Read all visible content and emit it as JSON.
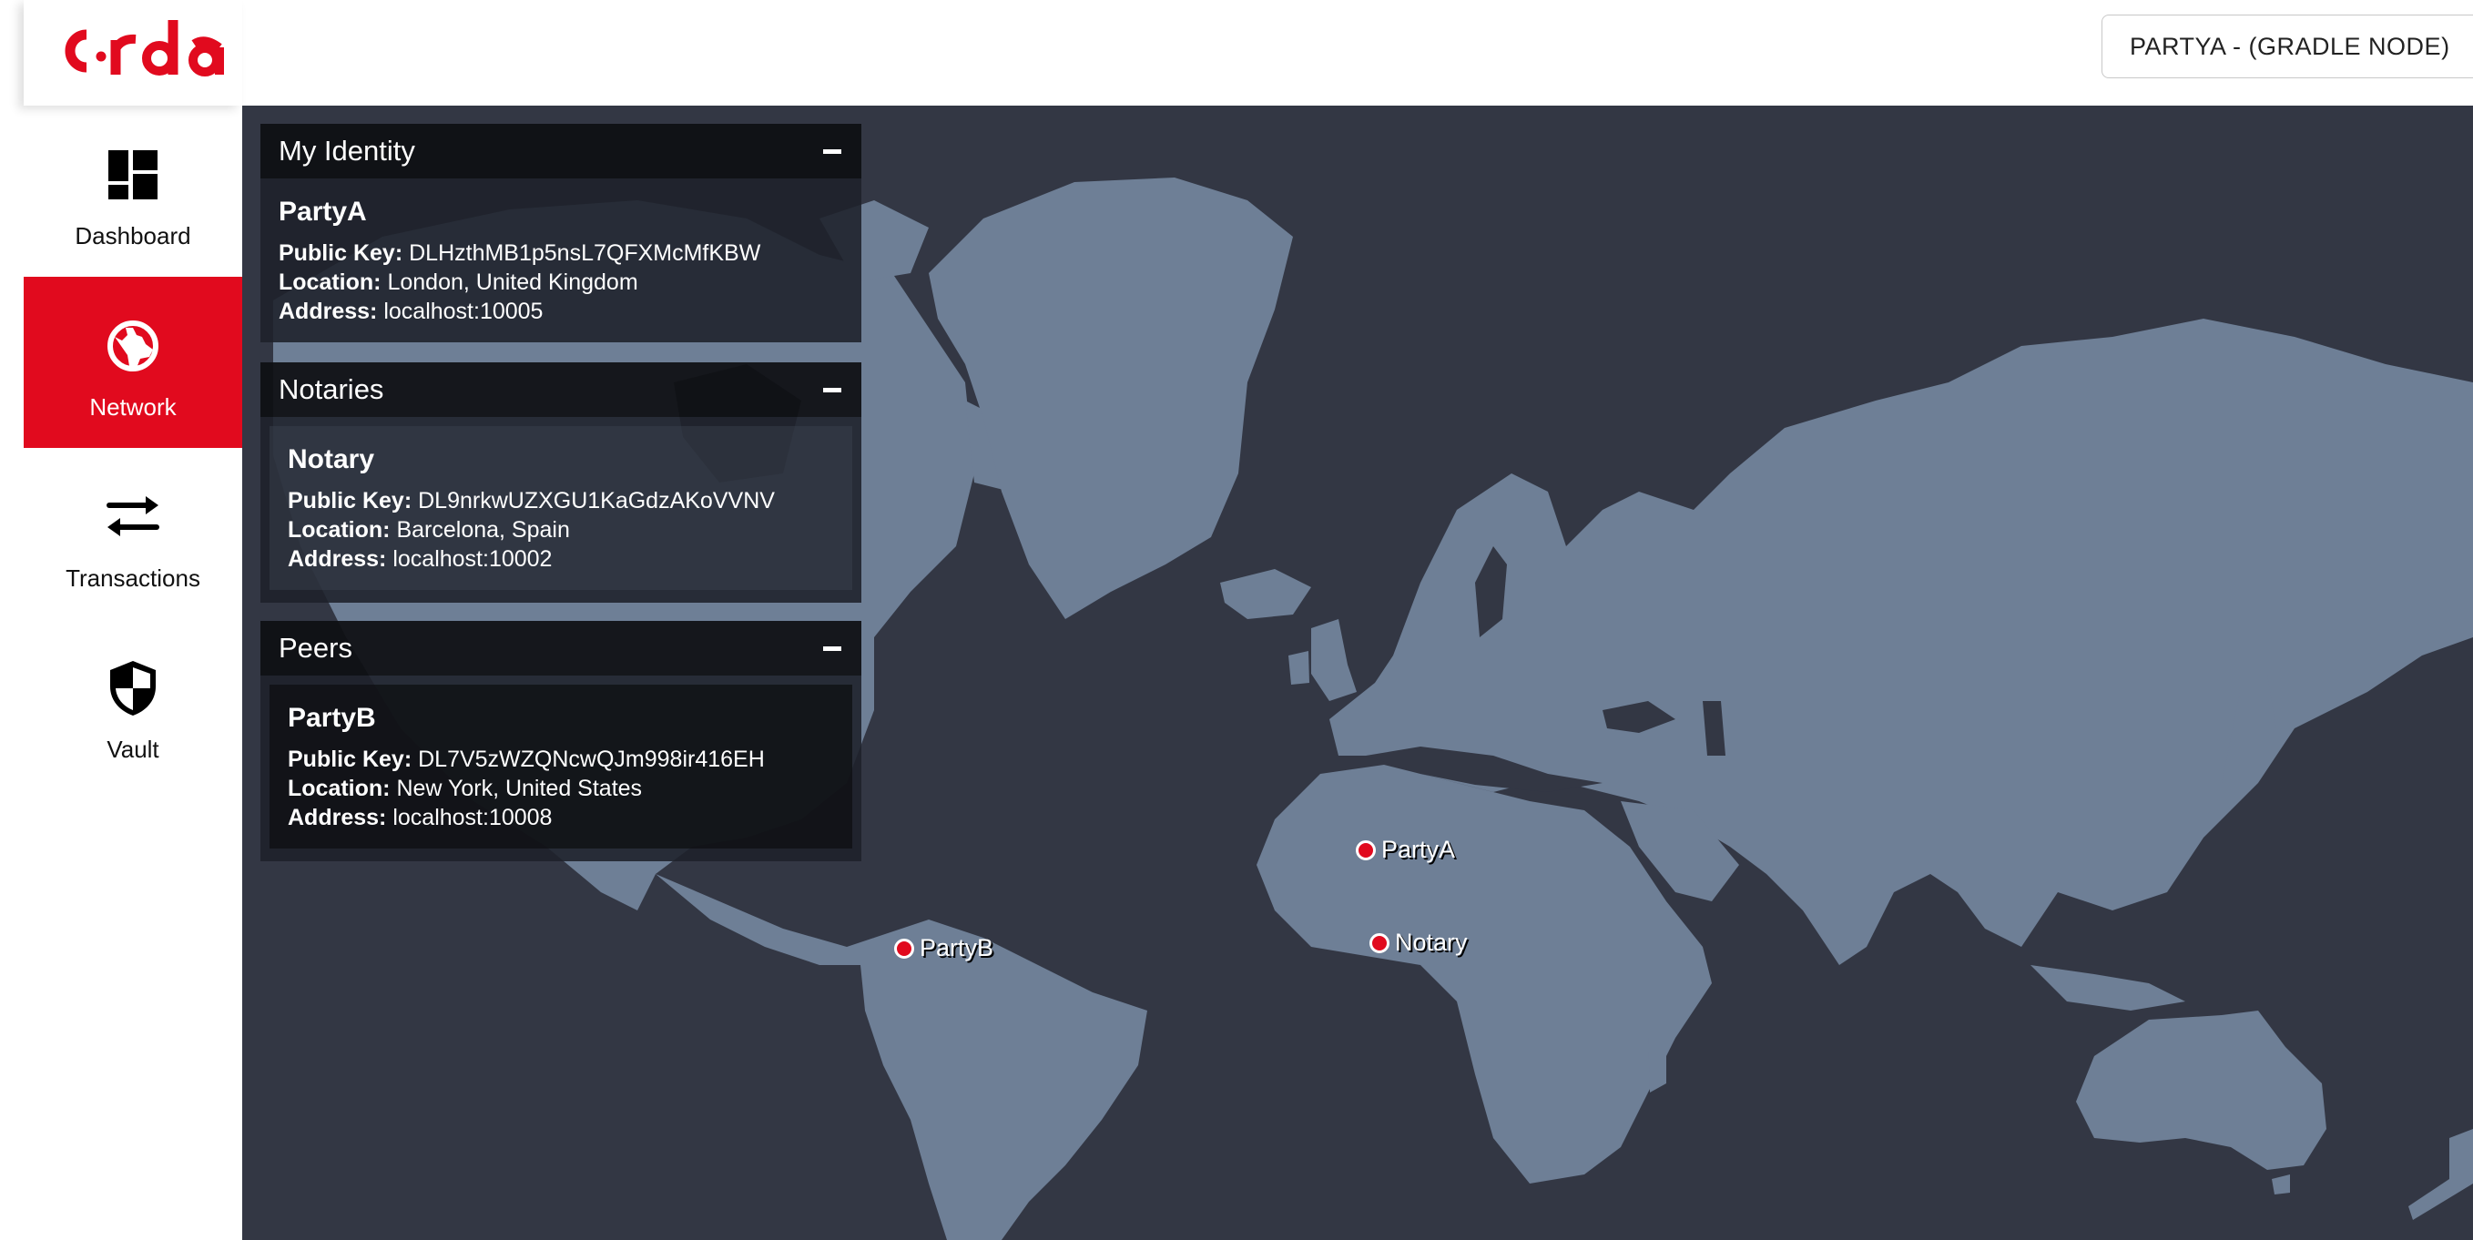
{
  "header": {
    "logo_text": "corda",
    "node_button_label": "PARTYA - (GRADLE NODE)"
  },
  "colors": {
    "accent": "#e10a1e",
    "sea": "#333744",
    "land": "#6e7f96",
    "panel_header": "#0e0f12"
  },
  "sidebar": {
    "items": [
      {
        "label": "Dashboard",
        "icon": "dashboard-icon",
        "active": false
      },
      {
        "label": "Network",
        "icon": "globe-icon",
        "active": true
      },
      {
        "label": "Transactions",
        "icon": "transfer-arrows-icon",
        "active": false
      },
      {
        "label": "Vault",
        "icon": "shield-icon",
        "active": false
      }
    ]
  },
  "panels": {
    "identity": {
      "title": "My Identity",
      "collapse": "−",
      "node": {
        "name": "PartyA",
        "public_key_label": "Public Key:",
        "public_key": "DLHzthMB1p5nsL7QFXMcMfKBW",
        "location_label": "Location:",
        "location": "London, United Kingdom",
        "address_label": "Address:",
        "address": "localhost:10005"
      }
    },
    "notaries": {
      "title": "Notaries",
      "collapse": "−",
      "nodes": [
        {
          "name": "Notary",
          "public_key_label": "Public Key:",
          "public_key": "DL9nrkwUZXGU1KaGdzAKoVVNV",
          "location_label": "Location:",
          "location": "Barcelona, Spain",
          "address_label": "Address:",
          "address": "localhost:10002"
        }
      ]
    },
    "peers": {
      "title": "Peers",
      "collapse": "−",
      "nodes": [
        {
          "name": "PartyB",
          "public_key_label": "Public Key:",
          "public_key": "DL7V5zWZQNcwQJm998ir416EH",
          "location_label": "Location:",
          "location": "New York, United States",
          "address_label": "Address:",
          "address": "localhost:10008"
        }
      ]
    }
  },
  "map": {
    "markers": [
      {
        "label": "PartyA"
      },
      {
        "label": "Notary"
      },
      {
        "label": "PartyB"
      }
    ]
  }
}
